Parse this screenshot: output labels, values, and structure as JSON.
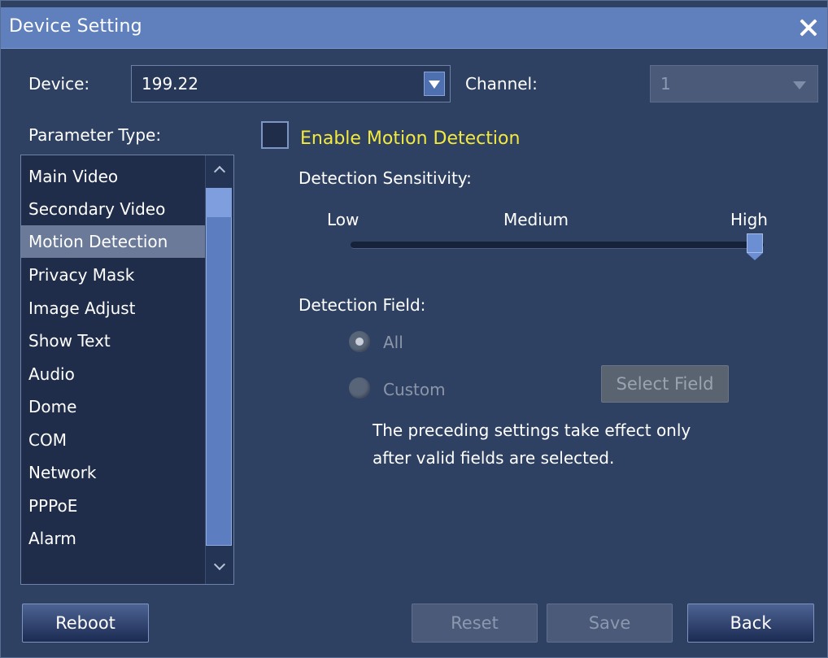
{
  "window": {
    "title": "Device Setting"
  },
  "device": {
    "label": "Device:",
    "value": "199.22"
  },
  "channel": {
    "label": "Channel:",
    "value": "1"
  },
  "parameter_type": {
    "label": "Parameter Type:",
    "items": [
      "Main Video",
      "Secondary Video",
      "Motion Detection",
      "Privacy Mask",
      "Image Adjust",
      "Show Text",
      "Audio",
      "Dome",
      "COM",
      "Network",
      "PPPoE",
      "Alarm"
    ],
    "selected": "Motion Detection"
  },
  "motion": {
    "enable_label": "Enable Motion Detection",
    "enabled": false,
    "sensitivity_label": "Detection Sensitivity:",
    "low": "Low",
    "medium": "Medium",
    "high": "High",
    "sensitivity_value": 0.96,
    "field_label": "Detection Field:",
    "all_label": "All",
    "custom_label": "Custom",
    "field_selected": "All",
    "select_field_label": "Select Field",
    "note_line1": "The preceding settings take effect only",
    "note_line2": "after valid fields are selected."
  },
  "buttons": {
    "reboot": "Reboot",
    "reset": "Reset",
    "save": "Save",
    "back": "Back"
  },
  "colors": {
    "title_bar": "#5f7fbd",
    "background": "#2f4163",
    "accent_yellow": "#f4ea3b"
  }
}
